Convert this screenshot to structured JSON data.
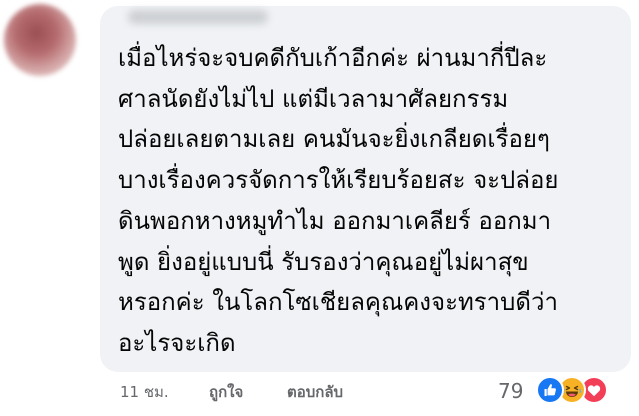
{
  "comment": {
    "lines": [
      "เมื่อไหร่จะจบคดีกับเก้าอีกค่ะ ผ่านมากี่ปีละ",
      "ศาลนัดยังไม่ไป แต่มีเวลามาศัลยกรรม",
      "ปล่อยเลยตามเลย คนมันจะยิ่งเกลียดเรื่อยๆ",
      "บางเรื่องควรจัดการให้เรียบร้อยสะ จะปล่อย",
      "ดินพอกหางหมูทำไม ออกมาเคลียร์ ออกมา",
      "พูด ยิ่งอยู่แบบนี่ รับรองว่าคุณอยู่ไม่ผาสุข",
      "หรอกค่ะ ในโลกโซเชียลคุณคงจะทราบดีว่า",
      "อะไรจะเกิด"
    ]
  },
  "footer": {
    "timestamp": "11 ชม.",
    "like_label": "ถูกใจ",
    "reply_label": "ตอบกลับ",
    "reaction_count": "79"
  },
  "reactions": [
    "like-icon",
    "haha-icon",
    "love-icon"
  ],
  "colors": {
    "bubble": "#f0f2f5",
    "text": "#050505",
    "meta": "#65676b",
    "like": "#1877f2",
    "haha": "#f7b125",
    "love": "#f33e58"
  }
}
